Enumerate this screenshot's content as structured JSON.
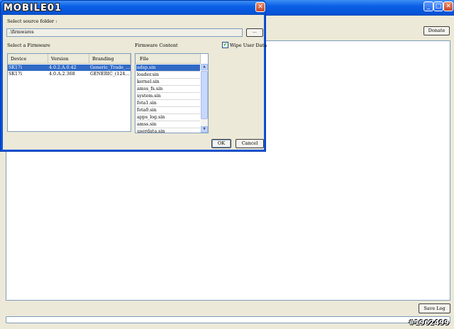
{
  "main": {
    "window_controls": {
      "minimize": "_",
      "maximize": "□",
      "close": "✕"
    },
    "donate_label": "Donate",
    "save_log_label": "Save Log",
    "progress_fraction": 0.0,
    "watermark_number": "#1962499"
  },
  "dialog": {
    "logo_text": "MOBILE01",
    "close_label": "✕",
    "source_folder_label": "Select source folder :",
    "source_folder_value": ".\\firmwares",
    "browse_label": "...",
    "select_firmware_label": "Select a Firmware",
    "firmware_content_label": "Firmware Content",
    "wipe_user_data_label": "Wipe User Data",
    "wipe_user_data_checked": true,
    "firmware_table": {
      "columns": [
        "Device",
        "Version",
        "Branding"
      ],
      "rows": [
        [
          "SK17i",
          "4.0.2.A.0.42",
          "Generic_Trade_..."
        ],
        [
          "SK17i",
          "4.0.A.2.368",
          "GENERIC_(124..."
        ]
      ],
      "selected_row": 0
    },
    "content_list": {
      "header": "File",
      "items": [
        "adsp.sin",
        "loader.sin",
        "kernel.sin",
        "amss_fs.sin",
        "system.sin",
        "fota1.sin",
        "fota0.sin",
        "apps_log.sin",
        "amss.sin",
        "userdata.sin"
      ],
      "selected_index": 0
    },
    "ok_label": "OK",
    "cancel_label": "Cancel"
  }
}
